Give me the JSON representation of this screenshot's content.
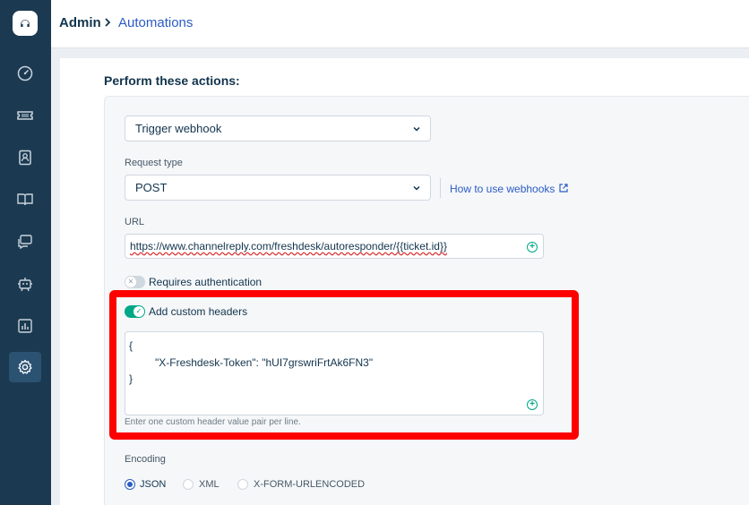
{
  "breadcrumb": {
    "admin": "Admin",
    "current": "Automations"
  },
  "sidebar": {
    "icons": [
      "dashboard-icon",
      "tickets-icon",
      "contacts-icon",
      "solutions-icon",
      "forums-icon",
      "bot-icon",
      "reports-icon",
      "admin-gear-icon"
    ],
    "active": "admin-gear-icon"
  },
  "section_title": "Perform these actions:",
  "action": {
    "selected": "Trigger webhook"
  },
  "request_type": {
    "label": "Request type",
    "selected": "POST",
    "help_link": "How to use webhooks"
  },
  "url": {
    "label": "URL",
    "value": "https://www.channelreply.com/freshdesk/autoresponder/{{ticket.id}}"
  },
  "requires_auth": {
    "label": "Requires authentication",
    "enabled": false
  },
  "custom_headers": {
    "label": "Add custom headers",
    "enabled": true,
    "lines": [
      "{",
      "\"X-Freshdesk-Token\": \"hUI7grswriFrtAk6FN3\"",
      "}"
    ],
    "hint": "Enter one custom header value pair per line."
  },
  "encoding": {
    "label": "Encoding",
    "options": [
      "JSON",
      "XML",
      "X-FORM-URLENCODED"
    ],
    "selected": "JSON"
  },
  "colors": {
    "sidebar": "#1b3a51",
    "accent": "#2c5cc5",
    "toggle_on": "#00a886",
    "highlight": "#ff0000"
  }
}
